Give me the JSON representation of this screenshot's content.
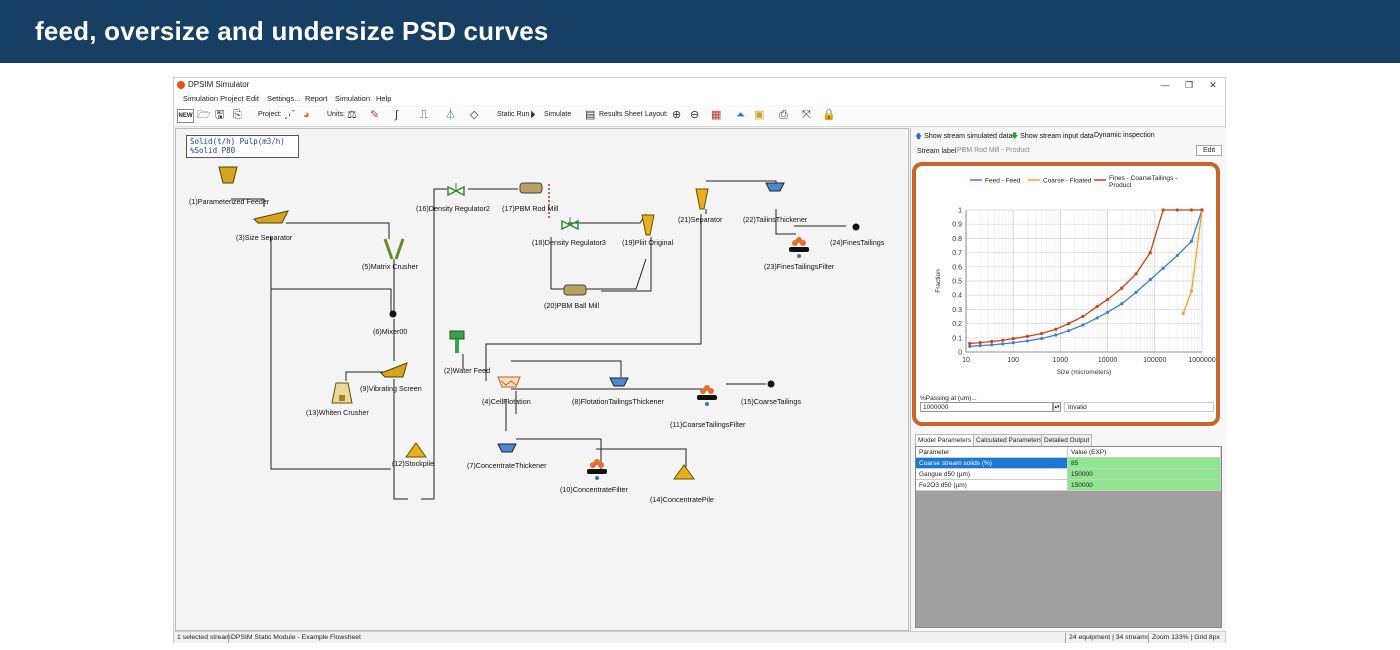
{
  "banner": {
    "title": "feed, oversize and undersize PSD curves"
  },
  "window": {
    "title": "DPSIM Simulator",
    "controls": [
      "—",
      "❐",
      "✕"
    ]
  },
  "menu": [
    "Simulation Project",
    "Edit",
    "Settings...",
    "Report",
    "Simulation",
    "Help"
  ],
  "toolbar": {
    "new_label": "NEW",
    "project_label": "Project:",
    "units_label": "Units:",
    "static_run_label": "Static Run",
    "simulate_label": "Simulate",
    "results_sheet_label": "Results Sheet",
    "layout_label": "Layout:"
  },
  "legend": {
    "line1": "Solid(t/h)   Pulp(m3/h)",
    "line2": "%Solid   P80"
  },
  "nodes": [
    "(1)Parameterized Feeder",
    "(3)Size Separator",
    "(5)Matrix Crusher",
    "(6)Mixer00",
    "(9)Vibrating Screen",
    "(13)Whiten Crusher",
    "(12)Stockpile",
    "(16)Density Regulator2",
    "(17)PBM Rod Mill",
    "(18)Density Regulator3",
    "(19)Pliit Original",
    "(20)PBM Ball Mill",
    "(21)Separator",
    "(22)TailinsThickener",
    "(23)FinesTailingsFilter",
    "(24)FinesTailings",
    "(2)Water Feed",
    "(4)CellFlotation",
    "(8)FlotationTailingsThickener",
    "(11)CoarseTailingsFilter",
    "(15)CoarseTailings",
    "(7)ConcentrateThickener",
    "(10)ConcentrateFilter",
    "(14)ConcentratePile"
  ],
  "right_panel": {
    "show_simulated": "Show stream simulated data",
    "show_input": "Show stream input data",
    "dynamic_inspection": "Dynamic inspection",
    "stream_label": "Stream label",
    "stream_value": "PBM Rod Mill - Product",
    "edit_label": "Edit",
    "passing_label": "%Passing at (um)...",
    "passing_value": "1000000",
    "passing_result": "Invalid",
    "tabs": [
      "Model Parameters",
      "Calculated Parameters",
      "Detailed Output"
    ],
    "table_headers": [
      "Parameter",
      "Value (EXP)"
    ],
    "table_rows": [
      {
        "param": "Coarse stream solids (%)",
        "value": "85"
      },
      {
        "param": "Gangue d50 (µm)",
        "value": "150000"
      },
      {
        "param": "Fe2O3 d50 (µm)",
        "value": "150000"
      }
    ]
  },
  "status": {
    "selected": "1 selected stream",
    "module": "DPSIM Static Module - Example Flowsheet",
    "equipment": "24 equipment | 34 streams",
    "zoom": "Zoom 133% | Grid 8px"
  },
  "chart_data": {
    "type": "line",
    "xlabel": "Size (micrometers)",
    "ylabel": "Fraction",
    "xscale": "log",
    "xlim": [
      10,
      1000000
    ],
    "ylim": [
      0,
      1
    ],
    "xticks": [
      "10",
      "100",
      "1000",
      "10000",
      "100000",
      "1000000"
    ],
    "yticks": [
      "0",
      "0.1",
      "0.2",
      "0.3",
      "0.4",
      "0.5",
      "0.6",
      "0.7",
      "0.8",
      "0.9",
      "1"
    ],
    "grid": true,
    "legend_position": "top",
    "colors": {
      "feed": "#3b7fd1",
      "coarse": "#f0a030",
      "fines": "#c8441c"
    },
    "series": [
      {
        "name": "Feed - Feed",
        "x": [
          12,
          20,
          35,
          60,
          100,
          200,
          400,
          800,
          1500,
          3000,
          6000,
          10000,
          20000,
          40000,
          80000,
          150000,
          300000,
          600000,
          1000000
        ],
        "y": [
          0.04,
          0.045,
          0.05,
          0.057,
          0.065,
          0.078,
          0.095,
          0.12,
          0.15,
          0.19,
          0.24,
          0.28,
          0.34,
          0.42,
          0.51,
          0.59,
          0.68,
          0.78,
          1.0
        ]
      },
      {
        "name": "Coarse - Floated",
        "x": [
          400000,
          600000,
          1000000
        ],
        "y": [
          0.27,
          0.43,
          1.0
        ]
      },
      {
        "name": "Fines - CoarseTailings - Product",
        "x": [
          12,
          20,
          35,
          60,
          100,
          200,
          400,
          800,
          1500,
          3000,
          6000,
          10000,
          20000,
          40000,
          80000,
          150000,
          300000,
          600000,
          1000000
        ],
        "y": [
          0.06,
          0.066,
          0.074,
          0.083,
          0.094,
          0.11,
          0.13,
          0.16,
          0.2,
          0.25,
          0.32,
          0.37,
          0.45,
          0.55,
          0.7,
          1.0,
          1.0,
          1.0,
          1.0
        ]
      }
    ]
  }
}
